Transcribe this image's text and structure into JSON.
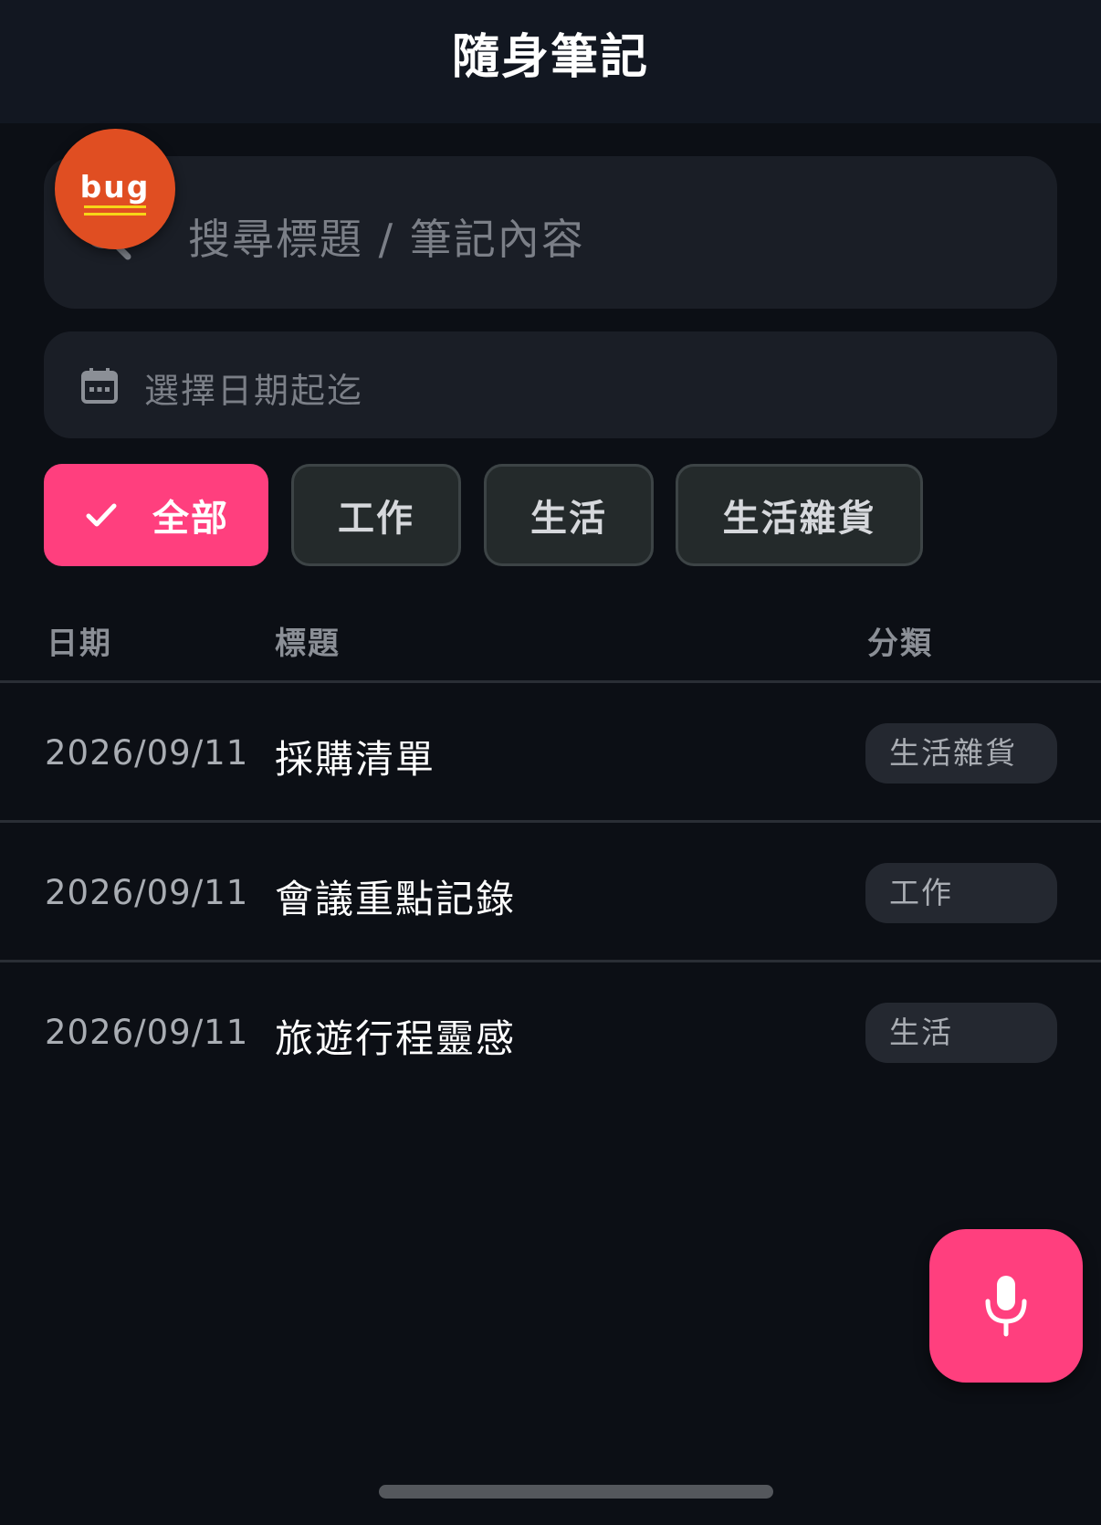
{
  "header": {
    "title": "隨身筆記"
  },
  "search": {
    "placeholder": "搜尋標題 / 筆記內容",
    "icon": "search-icon"
  },
  "debug_badge": {
    "label": "bug",
    "color": "#e04e22"
  },
  "date_filter": {
    "placeholder": "選擇日期起迄",
    "icon": "calendar-icon"
  },
  "filters": [
    {
      "label": "全部",
      "selected": true
    },
    {
      "label": "工作",
      "selected": false
    },
    {
      "label": "生活",
      "selected": false
    },
    {
      "label": "生活雜貨",
      "selected": false
    }
  ],
  "table": {
    "columns": [
      "日期",
      "標題",
      "分類"
    ],
    "rows": [
      {
        "date": "2026/09/11",
        "title": "採購清單",
        "category": "生活雜貨"
      },
      {
        "date": "2026/09/11",
        "title": "會議重點記錄",
        "category": "工作"
      },
      {
        "date": "2026/09/11",
        "title": "旅遊行程靈感",
        "category": "生活"
      }
    ]
  },
  "fab": {
    "icon": "microphone-icon"
  },
  "colors": {
    "accent": "#ff3f7e",
    "background": "#0c0f15",
    "surface": "#1a1e26"
  }
}
